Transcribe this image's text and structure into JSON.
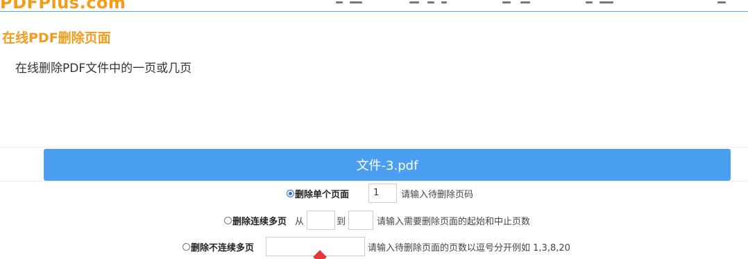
{
  "header": {
    "logo": "PDFPlus.com"
  },
  "page": {
    "title": "在线PDF删除页面",
    "subtitle": "在线删除PDF文件中的一页或几页"
  },
  "file": {
    "name": "文件-3.pdf"
  },
  "options": {
    "single": {
      "label": "删除单个页面",
      "value": "1",
      "hint": "请输入待删除页码",
      "checked": true
    },
    "range": {
      "label": "删除连续多页",
      "from_label": "从",
      "to_label": "到",
      "from_value": "",
      "to_value": "",
      "hint": "请输入需要删除页面的起始和中止页数",
      "checked": false
    },
    "list": {
      "label": "删除不连续多页",
      "value": "",
      "hint": "请输入待删除页面的页数以逗号分开例如 1,3,8,20",
      "checked": false
    }
  },
  "colors": {
    "accent": "#f39b1a",
    "file_bar": "#4a9ff0"
  }
}
